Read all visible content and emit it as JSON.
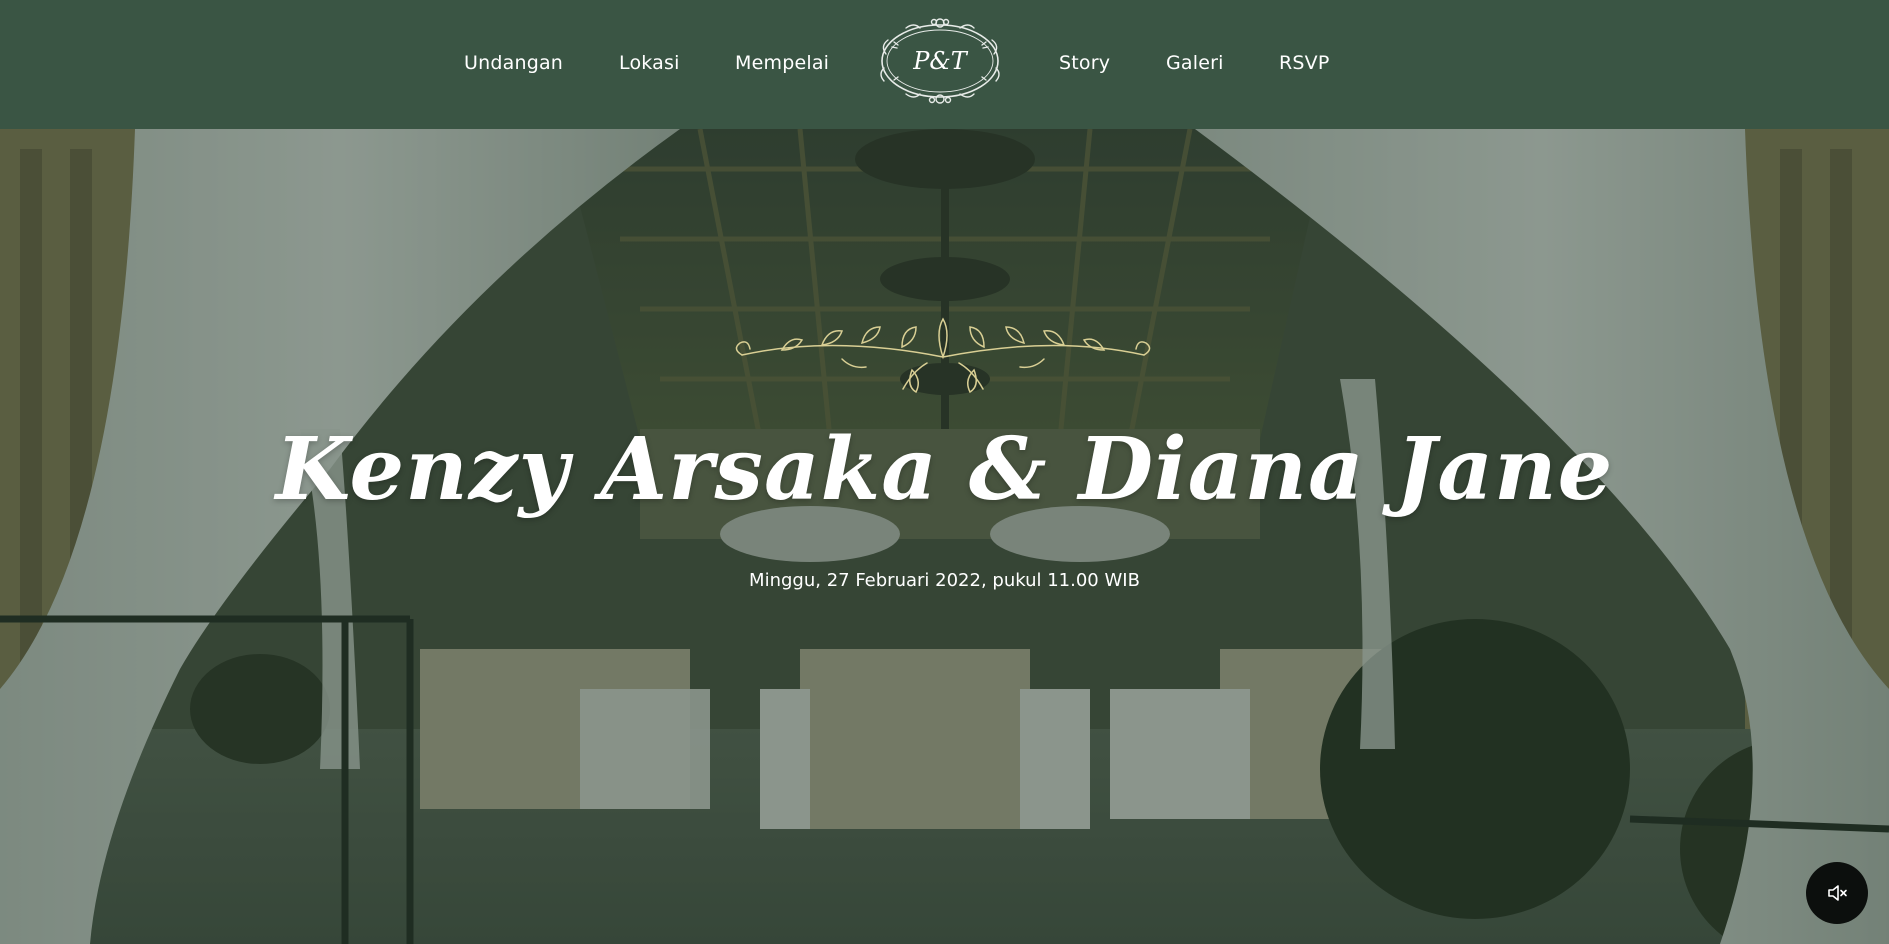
{
  "nav": {
    "left_items": [
      "Undangan",
      "Lokasi",
      "Mempelai"
    ],
    "right_items": [
      "Story",
      "Galeri",
      "RSVP"
    ],
    "logo_monogram": "P&T",
    "background_color": "#3a5544"
  },
  "hero": {
    "couple_names": "Kenzy Arsaka & Diana Jane",
    "event_date": "Minggu, 27 Februari 2022, pukul 11.00 WIB",
    "overlay_color": "#1e3426",
    "ornament_color": "#d9cf94"
  },
  "music": {
    "icon": "speaker-muted-icon"
  }
}
